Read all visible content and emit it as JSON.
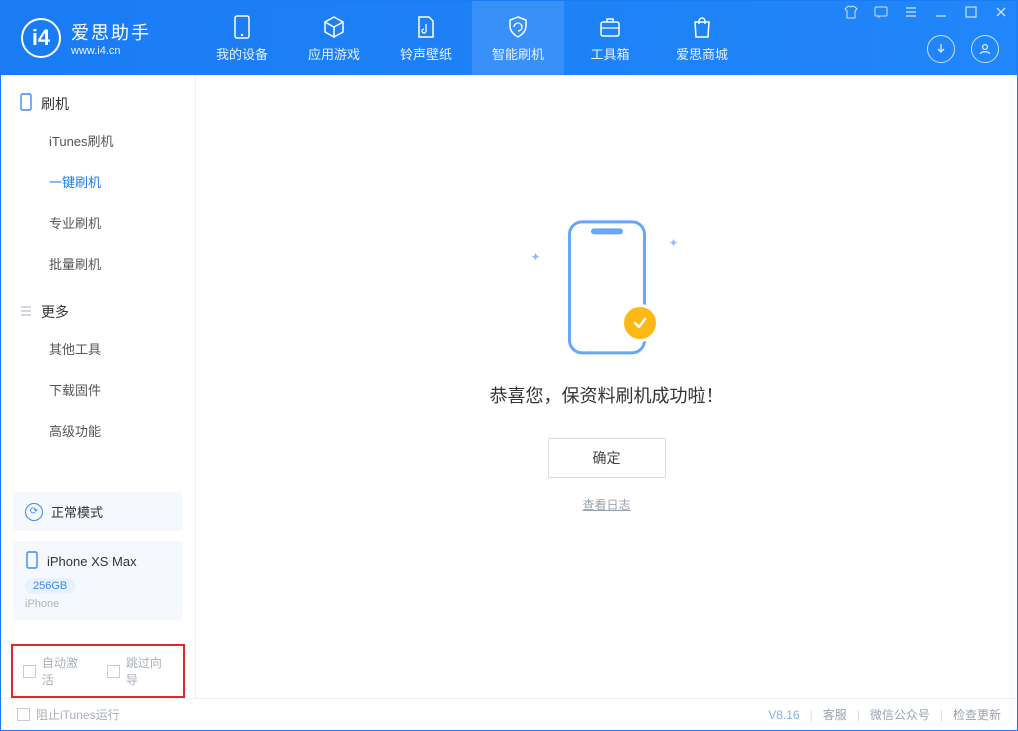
{
  "app": {
    "name": "爱思助手",
    "domain": "www.i4.cn",
    "logo_letter": "i4"
  },
  "nav": {
    "tabs": [
      "我的设备",
      "应用游戏",
      "铃声壁纸",
      "智能刷机",
      "工具箱",
      "爱思商城"
    ],
    "active_index": 3
  },
  "sidebar": {
    "section1": {
      "title": "刷机",
      "items": [
        "iTunes刷机",
        "一键刷机",
        "专业刷机",
        "批量刷机"
      ],
      "active_index": 1
    },
    "section2": {
      "title": "更多",
      "items": [
        "其他工具",
        "下载固件",
        "高级功能"
      ]
    },
    "mode_card": {
      "label": "正常模式"
    },
    "device_card": {
      "name": "iPhone XS Max",
      "storage": "256GB",
      "sub": "iPhone"
    },
    "options": {
      "auto_activate": "自动激活",
      "skip_guide": "跳过向导"
    }
  },
  "content": {
    "message": "恭喜您，保资料刷机成功啦！",
    "confirm": "确定",
    "view_log": "查看日志"
  },
  "statusbar": {
    "block_itunes": "阻止iTunes运行",
    "version": "V8.16",
    "links": [
      "客服",
      "微信公众号",
      "检查更新"
    ]
  }
}
